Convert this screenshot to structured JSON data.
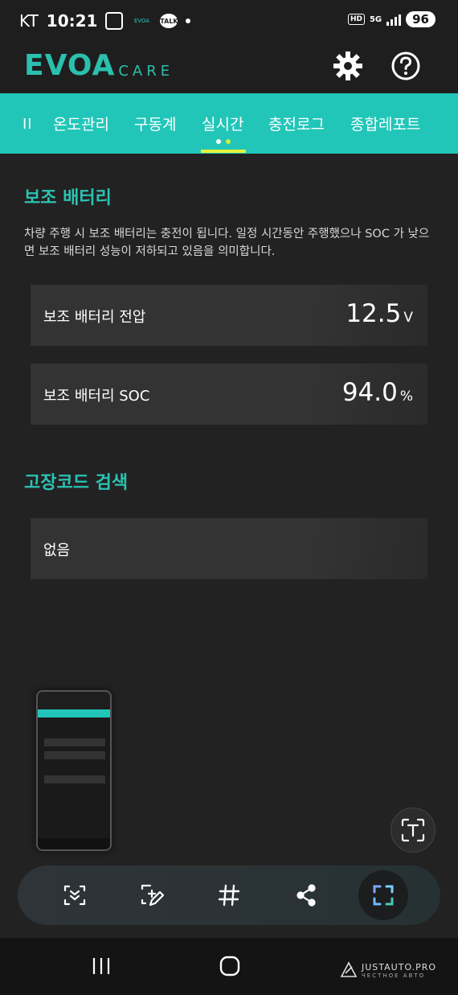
{
  "status_bar": {
    "carrier": "KT",
    "time": "10:21",
    "evoa_label": "EVOA",
    "talk_label": "TALK",
    "hd_label": "HD",
    "network": "5G",
    "battery": "96"
  },
  "header": {
    "logo_main": "EVOA",
    "logo_sub": "CARE",
    "settings_icon": "gear-icon",
    "help_icon": "help-icon"
  },
  "tabs": {
    "handle": "II",
    "items": [
      {
        "label": "온도관리"
      },
      {
        "label": "구동계"
      },
      {
        "label": "실시간"
      },
      {
        "label": "충전로그"
      },
      {
        "label": "종합레포트"
      }
    ],
    "active_index": 2,
    "indicator_color": "#e6f23a",
    "dots": [
      "#ffffff",
      "#c9f23a"
    ]
  },
  "aux_battery": {
    "title": "보조 배터리",
    "description": "차량 주행 시 보조 배터리는 충전이 됩니다. 일정 시간동안 주행했으나 SOC 가 낮으면 보조 배터리 성능이 저하되고 있음을 의미합니다.",
    "voltage": {
      "label": "보조 배터리 전압",
      "value": "12.5",
      "unit": "V"
    },
    "soc": {
      "label": "보조 배터리 SOC",
      "value": "94.0",
      "unit": "%"
    }
  },
  "fault_codes": {
    "title": "고장코드 검색",
    "result": "없음"
  },
  "capture_toolbar": {
    "tools": [
      "scroll-capture-icon",
      "draw-icon",
      "hashtag-icon",
      "share-icon",
      "crop-icon"
    ],
    "active_tool": "crop-icon",
    "text_extract_icon": "text-extract-icon"
  },
  "watermark": {
    "main": "JUSTAUTO.PRO",
    "sub": "ЧЕСТНОЕ АВТО"
  },
  "colors": {
    "accent": "#22c6b8",
    "title_teal": "#2bc3b3",
    "background": "#222222"
  }
}
